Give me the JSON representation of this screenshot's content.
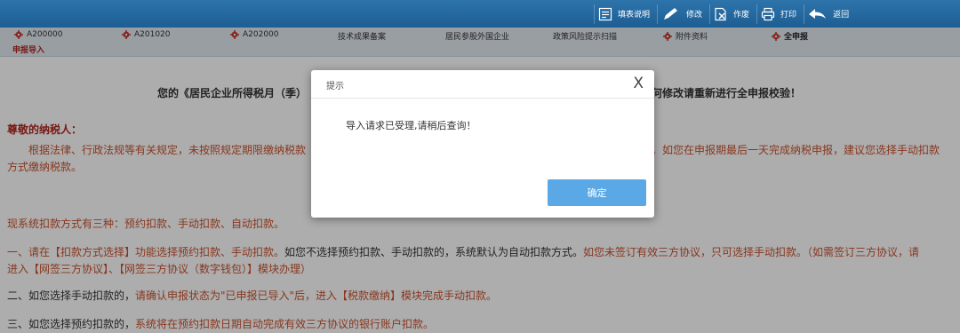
{
  "toolbar": {
    "items": [
      {
        "label": "填表说明",
        "icon": "doc-icon"
      },
      {
        "label": "修改",
        "icon": "pen-icon"
      },
      {
        "label": "作废",
        "icon": "void-icon"
      },
      {
        "label": "打印",
        "icon": "print-icon"
      },
      {
        "label": "返回",
        "icon": "back-arrow-icon"
      }
    ]
  },
  "tabs": [
    {
      "label": "A200000",
      "gear": true
    },
    {
      "label": "A201020",
      "gear": true
    },
    {
      "label": "A202000",
      "gear": true
    },
    {
      "label": "技术成果备案",
      "gear": false
    },
    {
      "label": "居民参股外国企业",
      "gear": false
    },
    {
      "label": "政策风险提示扫描",
      "gear": false
    },
    {
      "label": "附件资料",
      "gear": true
    },
    {
      "label": "全申报",
      "gear": true
    }
  ],
  "import_tab": "申报导入",
  "content": {
    "notice_left": "您的《居民企业所得税月（季）",
    "notice_right": "何修改请重新进行全申报校验！",
    "greeting": "尊敬的纳税人：",
    "p1_left_line1": "根据法律、行政法规等有关规定，未按照规定期限缴纳税款",
    "p1_right_line1": "。如您在申报期最后一天完成纳税申报，建议您选择手动扣款",
    "p1_line2": "方式缴纳税款。",
    "p2": "现系统扣款方式有三种：预约扣款、手动扣款、自动扣款。",
    "p3_a": "一、请在【扣款方式选择】功能选择预约扣款、手动扣款。",
    "p3_b": "如您不选择预约扣款、手动扣款的，系统默认为自动扣款方式。",
    "p3_c": "如您未签订有效三方协议，只可选择手动扣款。（如需签订三方协议，请",
    "p3_d": "进入【网签三方协议】、【网签三方协议（数字钱包）】模块办理）",
    "p4_a": "二、如您选择手动扣款的，",
    "p4_b": "请确认申报状态为\"已申报已导入\"后，进入【税款缴纳】模块完成手动扣款。",
    "p5_a": "三、如您选择预约扣款的，",
    "p5_b": "系统将在预约扣款日期自动完成有效三方协议的银行账户扣款。"
  },
  "dialog": {
    "title": "提示",
    "close": "X",
    "message": "导入请求已受理,请稍后查询！",
    "confirm": "确定"
  },
  "colors": {
    "toolbar": "#1d5e93",
    "gear": "#c0392b",
    "red_text": "#c9522e",
    "button": "#5aa9e6"
  }
}
